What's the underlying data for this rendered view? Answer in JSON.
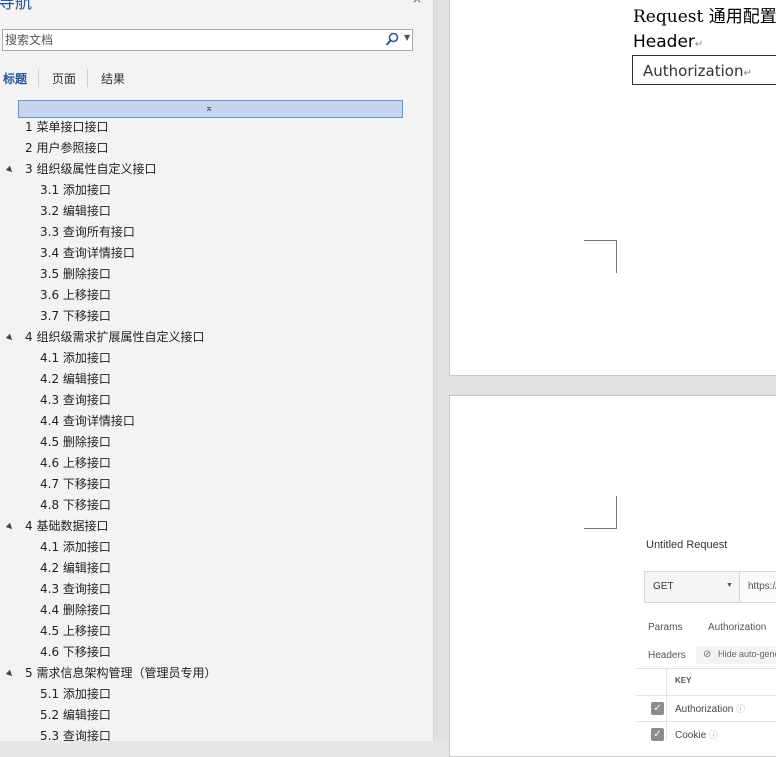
{
  "nav": {
    "title": "导航",
    "close": "×",
    "search_placeholder": "搜索文档",
    "tabs": [
      "标题",
      "页面",
      "结果"
    ],
    "collapse_glyph": "⌅",
    "tree": [
      {
        "text": "1  菜单接口接口",
        "level": 1,
        "expanded": false
      },
      {
        "text": "2  用户参照接口",
        "level": 1,
        "expanded": false
      },
      {
        "text": "3  组织级属性自定义接口",
        "level": 1,
        "expanded": true
      },
      {
        "text": "3.1  添加接口",
        "level": 2
      },
      {
        "text": "3.2  编辑接口",
        "level": 2
      },
      {
        "text": "3.3  查询所有接口",
        "level": 2
      },
      {
        "text": "3.4  查询详情接口",
        "level": 2
      },
      {
        "text": "3.5  删除接口",
        "level": 2
      },
      {
        "text": "3.6  上移接口",
        "level": 2
      },
      {
        "text": "3.7  下移接口",
        "level": 2
      },
      {
        "text": "4  组织级需求扩展属性自定义接口",
        "level": 1,
        "expanded": true
      },
      {
        "text": "4.1  添加接口",
        "level": 2
      },
      {
        "text": "4.2  编辑接口",
        "level": 2
      },
      {
        "text": "4.3  查询接口",
        "level": 2
      },
      {
        "text": "4.4  查询详情接口",
        "level": 2
      },
      {
        "text": "4.5  删除接口",
        "level": 2
      },
      {
        "text": "4.6  上移接口",
        "level": 2
      },
      {
        "text": "4.7  下移接口",
        "level": 2
      },
      {
        "text": "4.8  下移接口",
        "level": 2
      },
      {
        "text": "4  基础数据接口",
        "level": 1,
        "expanded": true
      },
      {
        "text": "4.1  添加接口",
        "level": 2
      },
      {
        "text": "4.2  编辑接口",
        "level": 2
      },
      {
        "text": "4.3  查询接口",
        "level": 2
      },
      {
        "text": "4.4  删除接口",
        "level": 2
      },
      {
        "text": "4.5  上移接口",
        "level": 2
      },
      {
        "text": "4.6  下移接口",
        "level": 2
      },
      {
        "text": "5  需求信息架构管理（管理员专用）",
        "level": 1,
        "expanded": true
      },
      {
        "text": "5.1  添加接口",
        "level": 2
      },
      {
        "text": "5.2  编辑接口",
        "level": 2
      },
      {
        "text": "5.3  查询接口",
        "level": 2
      }
    ]
  },
  "document": {
    "line1": "Request 通用配置",
    "line2": "Header",
    "cell": "Authorization",
    "para_mark": "↵"
  },
  "postman": {
    "title": "Untitled Request",
    "method": "GET",
    "url": "https://",
    "tab_params": "Params",
    "tab_auth": "Authorization",
    "headers_label": "Headers",
    "hide_auto": "Hide auto-generated",
    "key_header": "KEY",
    "rows": [
      "Authorization",
      "Cookie"
    ]
  },
  "colors": {
    "accent": "#2b579a",
    "selection_bg": "#c5d5ef",
    "selection_border": "#7393c4"
  }
}
